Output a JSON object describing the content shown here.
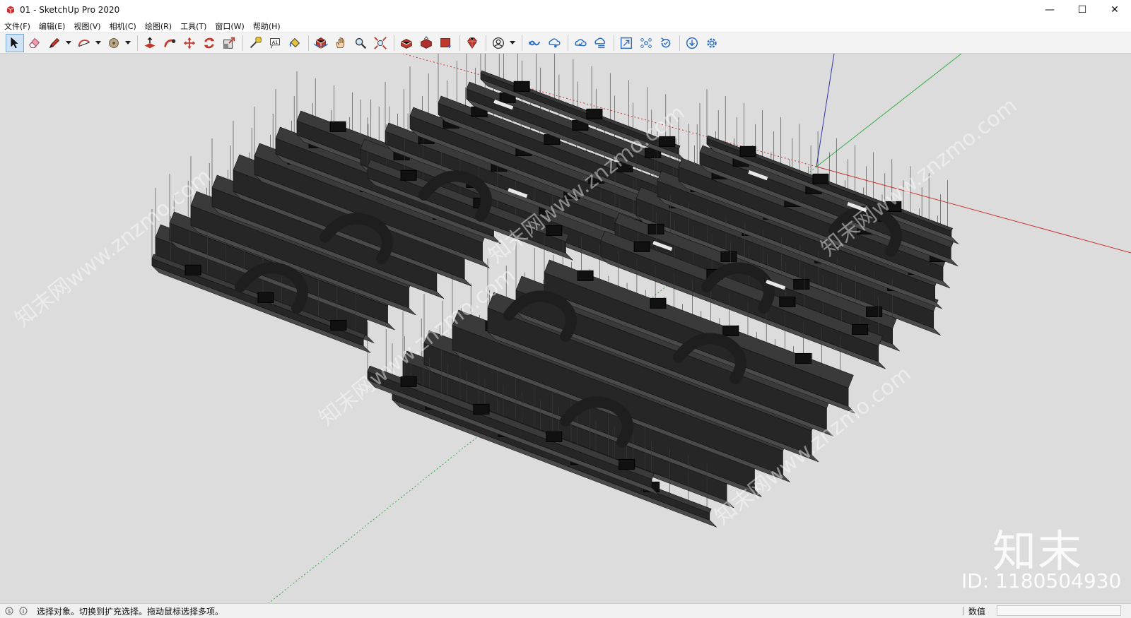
{
  "window": {
    "title": "01 - SketchUp Pro 2020",
    "minimize": "—",
    "maximize": "☐",
    "close": "✕"
  },
  "menu": [
    "文件(F)",
    "编辑(E)",
    "视图(V)",
    "相机(C)",
    "绘图(R)",
    "工具(T)",
    "窗口(W)",
    "帮助(H)"
  ],
  "toolbar": {
    "tools": [
      {
        "name": "select-icon",
        "active": true
      },
      {
        "name": "eraser-icon"
      },
      {
        "name": "pencil-icon",
        "dropdown": true
      },
      {
        "name": "arc-icon",
        "dropdown": true
      },
      {
        "name": "shape-icon",
        "dropdown": true
      },
      {
        "sep": true
      },
      {
        "name": "push-pull-icon"
      },
      {
        "name": "follow-me-icon"
      },
      {
        "name": "move-icon"
      },
      {
        "name": "rotate-icon"
      },
      {
        "name": "scale-icon"
      },
      {
        "sep": true
      },
      {
        "name": "tape-measure-icon"
      },
      {
        "name": "text-icon"
      },
      {
        "name": "paint-bucket-icon"
      },
      {
        "sep": true
      },
      {
        "name": "orbit-icon"
      },
      {
        "name": "pan-icon"
      },
      {
        "name": "zoom-icon"
      },
      {
        "name": "zoom-extents-icon"
      },
      {
        "sep": true
      },
      {
        "name": "warehouse-icon"
      },
      {
        "name": "share-model-icon"
      },
      {
        "name": "extension-warehouse-icon"
      },
      {
        "sep": true
      },
      {
        "name": "ruby-icon"
      },
      {
        "sep": true
      },
      {
        "name": "account-icon",
        "dropdown": true
      },
      {
        "sep": true
      },
      {
        "name": "trimble-connect-icon"
      },
      {
        "name": "collaborate-icon"
      },
      {
        "sep": true
      },
      {
        "name": "cloud-sync-icon"
      },
      {
        "name": "cloud-list-icon"
      },
      {
        "sep": true
      },
      {
        "name": "frame-icon"
      },
      {
        "name": "network-icon"
      },
      {
        "name": "refresh-icon"
      },
      {
        "sep": true
      },
      {
        "name": "download-icon"
      },
      {
        "name": "settings-gear-icon"
      }
    ]
  },
  "watermark": {
    "logo": "知末",
    "id": "ID: 1180504930",
    "text": "知末网www.znzmo.com"
  },
  "status": {
    "text": "选择对象。切换到扩充选择。拖动鼠标选择多项。",
    "measure_label": "数值",
    "measure_value": ""
  },
  "colors": {
    "background": "#dcdcdc",
    "axis_red": "#cc3333",
    "axis_green": "#33aa44",
    "axis_blue": "#3333aa",
    "duct": "#262626",
    "duct_top": "#3a3a3a"
  }
}
